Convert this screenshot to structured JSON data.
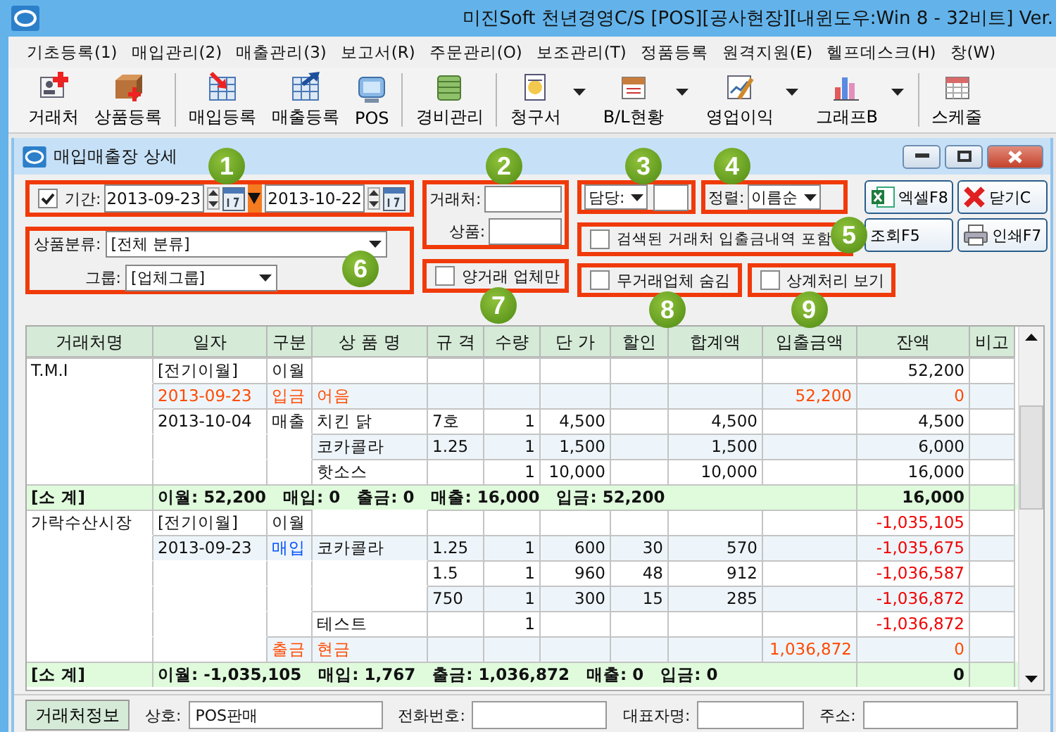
{
  "window": {
    "title": "미진Soft 천년경영C/S [POS][공사현장][내윈도우:Win 8 - 32비트] Ver."
  },
  "menu": [
    "기초등록(1)",
    "매입관리(2)",
    "매출관리(3)",
    "보고서(R)",
    "주문관리(O)",
    "보조관리(T)",
    "정품등록",
    "원격지원(E)",
    "헬프데스크(H)",
    "창(W)"
  ],
  "toolbar": [
    {
      "label": "거래처",
      "dropdown": false,
      "separator_before": false
    },
    {
      "label": "상품등록",
      "dropdown": false,
      "separator_before": false
    },
    {
      "label": "매입등록",
      "dropdown": false,
      "separator_before": true
    },
    {
      "label": "매출등록",
      "dropdown": false,
      "separator_before": false
    },
    {
      "label": "POS",
      "dropdown": false,
      "separator_before": false
    },
    {
      "label": "경비관리",
      "dropdown": false,
      "separator_before": true
    },
    {
      "label": "청구서",
      "dropdown": true,
      "separator_before": true
    },
    {
      "label": "B/L현황",
      "dropdown": true,
      "separator_before": false
    },
    {
      "label": "영업이익",
      "dropdown": true,
      "separator_before": false
    },
    {
      "label": "그래프B",
      "dropdown": true,
      "separator_before": false
    },
    {
      "label": "스케줄",
      "dropdown": false,
      "separator_before": true
    }
  ],
  "child_window": {
    "title": "매입매출장 상세"
  },
  "filters": {
    "period": {
      "checked": true,
      "label": "기간:",
      "from": "2013-09-23",
      "to": "2013-10-22",
      "badge": "1"
    },
    "partner": {
      "label": "거래처:",
      "product_label": "상품:",
      "badge": "2"
    },
    "manager": {
      "label": "담당:",
      "badge": "3"
    },
    "sort": {
      "label": "정렬:",
      "value": "이름순",
      "badge": "4"
    },
    "include": {
      "label": "검색된 거래처 입출금내역 포함",
      "checked": false,
      "badge": "5"
    },
    "category": {
      "label": "상품분류:",
      "value": "[전체 분류]",
      "group_label": "그룹:",
      "group_value": "[업체그룹]",
      "badge": "6"
    },
    "options": [
      {
        "label": "양거래 업체만",
        "checked": false,
        "badge": "7"
      },
      {
        "label": "무거래업체 숨김",
        "checked": false,
        "badge": "8"
      },
      {
        "label": "상계처리 보기",
        "checked": false,
        "badge": "9"
      }
    ]
  },
  "buttons": [
    "엑셀F8",
    "닫기C",
    "조회F5",
    "인쇄F7"
  ],
  "table": {
    "columns": [
      "거래처명",
      "일자",
      "구분",
      "상 품 명",
      "규 격",
      "수량",
      "단 가",
      "할인",
      "합계액",
      "입출금액",
      "잔액",
      "비고"
    ],
    "rows": [
      {
        "kind": "carry",
        "partner": "T.M.I",
        "date": "[전기이월]",
        "type": "이월",
        "balance": "52,200",
        "negative": false
      },
      {
        "kind": "payment",
        "date": "2013-09-23",
        "type": "입금",
        "product": "어음",
        "amount": "52,200",
        "balance": "0",
        "negative": false
      },
      {
        "kind": "sale",
        "date": "2013-10-04",
        "type": "매출",
        "product": "치킨 닭",
        "spec": "7호",
        "qty": "1",
        "price": "4,500",
        "total": "4,500",
        "balance": "4,500",
        "negative": false
      },
      {
        "kind": "sale",
        "product": "코카콜라",
        "spec": "1.25",
        "qty": "1",
        "price": "1,500",
        "total": "1,500",
        "balance": "6,000",
        "negative": false
      },
      {
        "kind": "sale",
        "product": "핫소스",
        "qty": "1",
        "price": "10,000",
        "total": "10,000",
        "balance": "16,000",
        "negative": false
      },
      {
        "kind": "subtotal",
        "label": "[소 계]",
        "summary": "이월: 52,200   매입: 0   출금: 0   매출: 16,000   입금: 52,200",
        "balance": "16,000"
      },
      {
        "kind": "carry",
        "partner": "가락수산시장",
        "date": "[전기이월]",
        "type": "이월",
        "balance": "-1,035,105",
        "negative": true
      },
      {
        "kind": "purchase",
        "date": "2013-09-23",
        "type": "매입",
        "product": "코카콜라",
        "spec": "1.25",
        "qty": "1",
        "price": "600",
        "discount": "30",
        "total": "570",
        "balance": "-1,035,675",
        "negative": true
      },
      {
        "kind": "purchase",
        "spec": "1.5",
        "qty": "1",
        "price": "960",
        "discount": "48",
        "total": "912",
        "balance": "-1,036,587",
        "negative": true
      },
      {
        "kind": "purchase",
        "spec": "750",
        "qty": "1",
        "price": "300",
        "discount": "15",
        "total": "285",
        "balance": "-1,036,872",
        "negative": true
      },
      {
        "kind": "purchase",
        "product": "테스트",
        "qty": "1",
        "balance": "-1,036,872",
        "negative": true
      },
      {
        "kind": "payment",
        "type": "출금",
        "product": "현금",
        "amount": "1,036,872",
        "balance": "0",
        "negative": false
      },
      {
        "kind": "subtotal",
        "label": "[소 계]",
        "summary": "이월: -1,035,105   매입: 1,767   출금: 1,036,872   매출: 0   입금: 0",
        "balance": "0"
      }
    ]
  },
  "footer": {
    "button": "거래처정보",
    "fields": [
      {
        "label": "상호:",
        "value": "POS판매"
      },
      {
        "label": "전화번호:"
      },
      {
        "label": "대표자명:"
      },
      {
        "label": "주소:"
      }
    ]
  }
}
